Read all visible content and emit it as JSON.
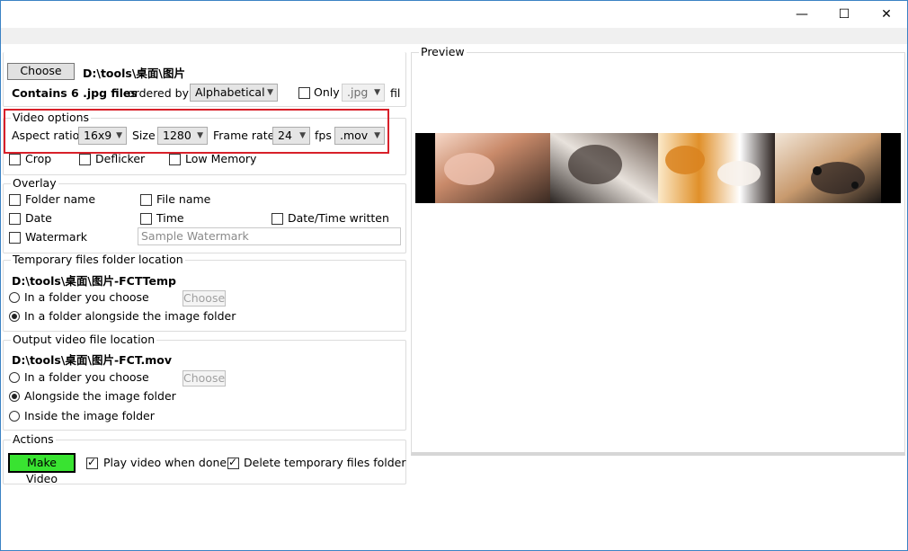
{
  "window": {
    "controls": {
      "minimize": "—",
      "maximize": "☐",
      "close": "✕"
    }
  },
  "source": {
    "choose_label": "Choose",
    "path": "D:\\tools\\桌面\\图片",
    "contains_text": "Contains 6 .jpg files",
    "ordered_by_label": "ordered by",
    "order_value": "Alphabetical",
    "only_label": "Only",
    "ext_value": ".jpg",
    "fil_label": "fil"
  },
  "video_options": {
    "title": "Video options",
    "aspect_label": "Aspect ratio",
    "aspect_value": "16x9",
    "size_label": "Size",
    "size_value": "1280",
    "frame_rate_label": "Frame rate",
    "frame_rate_value": "24",
    "fps_label": "fps",
    "format_value": ".mov",
    "crop_label": "Crop",
    "deflicker_label": "Deflicker",
    "low_memory_label": "Low Memory"
  },
  "overlay": {
    "title": "Overlay",
    "folder_name": "Folder name",
    "file_name": "File name",
    "date": "Date",
    "time": "Time",
    "datetime_written": "Date/Time written",
    "watermark": "Watermark",
    "watermark_placeholder": "Sample Watermark"
  },
  "temp_folder": {
    "title": "Temporary files folder location",
    "path": "D:\\tools\\桌面\\图片-FCTTemp",
    "option_choose": "In a folder you choose",
    "choose_label": "Choose",
    "option_alongside": "In a folder alongside the image folder"
  },
  "output": {
    "title": "Output video file location",
    "path": "D:\\tools\\桌面\\图片-FCT.mov",
    "option_choose": "In a folder you choose",
    "choose_label": "Choose",
    "option_alongside": "Alongside the image folder",
    "option_inside": "Inside the image folder"
  },
  "actions": {
    "title": "Actions",
    "make_video_label": "Make Video",
    "make_video_color": "#39e331",
    "play_video_label": "Play video when done",
    "delete_temp_label": "Delete temporary files folder"
  },
  "preview": {
    "title": "Preview"
  },
  "colors": {
    "highlight": "#d8202a",
    "window_border": "#3b82c4"
  }
}
